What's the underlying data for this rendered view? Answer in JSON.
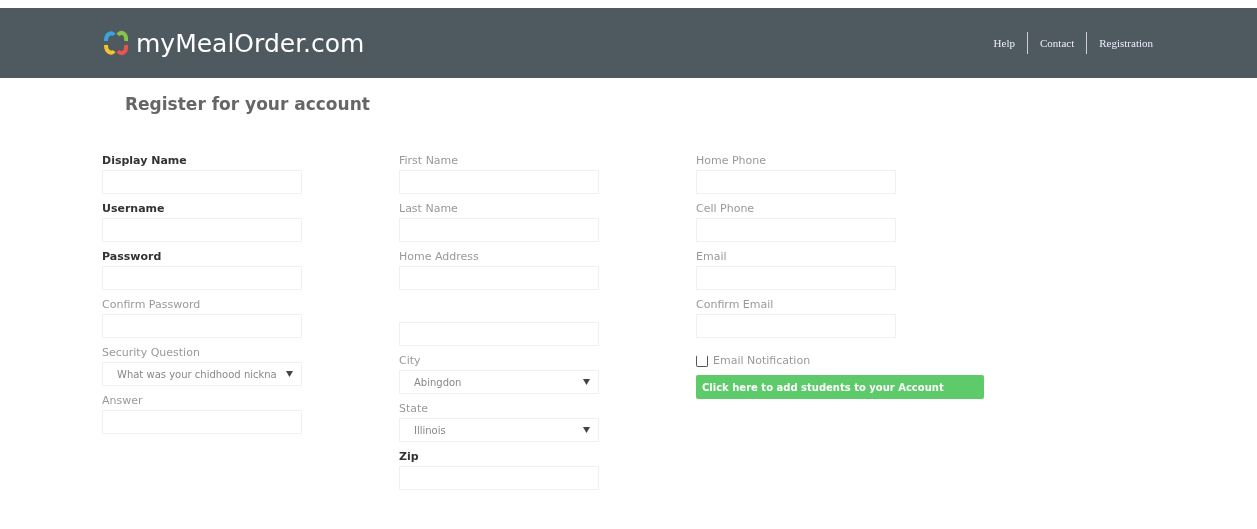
{
  "header": {
    "logo_text": "myMealOrder.com",
    "nav": [
      "Help",
      "Contact",
      "Registration"
    ]
  },
  "title": "Register for your account",
  "columns": [
    [
      {
        "kind": "text",
        "label": "Display Name",
        "required": true
      },
      {
        "kind": "text",
        "label": "Username",
        "required": true
      },
      {
        "kind": "text",
        "label": "Password",
        "required": true
      },
      {
        "kind": "text",
        "label": "Confirm Password",
        "required": false
      },
      {
        "kind": "select",
        "label": "Security Question",
        "required": false,
        "value": "What was your chidhood nickna"
      },
      {
        "kind": "text",
        "label": "Answer",
        "required": false
      }
    ],
    [
      {
        "kind": "text",
        "label": "First Name",
        "required": false
      },
      {
        "kind": "text",
        "label": "Last Name",
        "required": false
      },
      {
        "kind": "address",
        "label": "Home Address",
        "required": false
      },
      {
        "kind": "select",
        "label": "City",
        "required": false,
        "value": "Abingdon"
      },
      {
        "kind": "select",
        "label": "State",
        "required": false,
        "value": "Illinois"
      },
      {
        "kind": "text",
        "label": "Zip",
        "required": true
      }
    ],
    [
      {
        "kind": "text",
        "label": "Home Phone",
        "required": false
      },
      {
        "kind": "text",
        "label": "Cell Phone",
        "required": false
      },
      {
        "kind": "text",
        "label": "Email",
        "required": false
      },
      {
        "kind": "text",
        "label": "Confirm Email",
        "required": false
      },
      {
        "kind": "checkbox",
        "label": "Email Notification",
        "checked": false
      },
      {
        "kind": "button",
        "label": "Click here to add students to your Account"
      }
    ]
  ]
}
